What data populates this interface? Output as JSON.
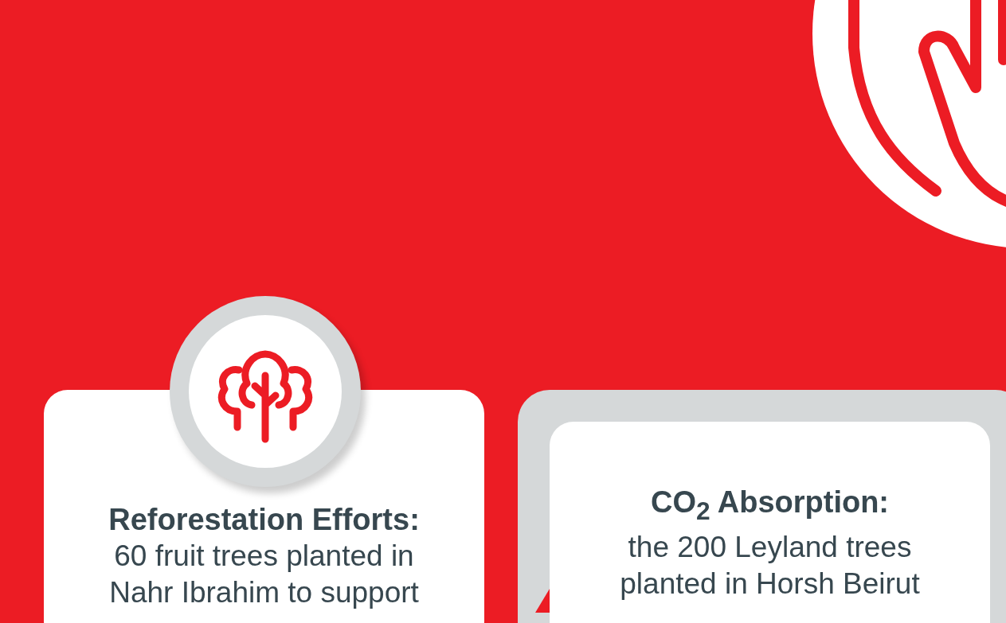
{
  "cards": [
    {
      "kind": "icon",
      "heading": "Reforestation Efforts:",
      "body": "60 fruit trees planted in Nahr Ibrahim to support"
    },
    {
      "kind": "framed",
      "heading": "CO$_{2}$ Absorption:",
      "body": "the 200 Leyland trees planted in Horsh Beirut"
    }
  ]
}
